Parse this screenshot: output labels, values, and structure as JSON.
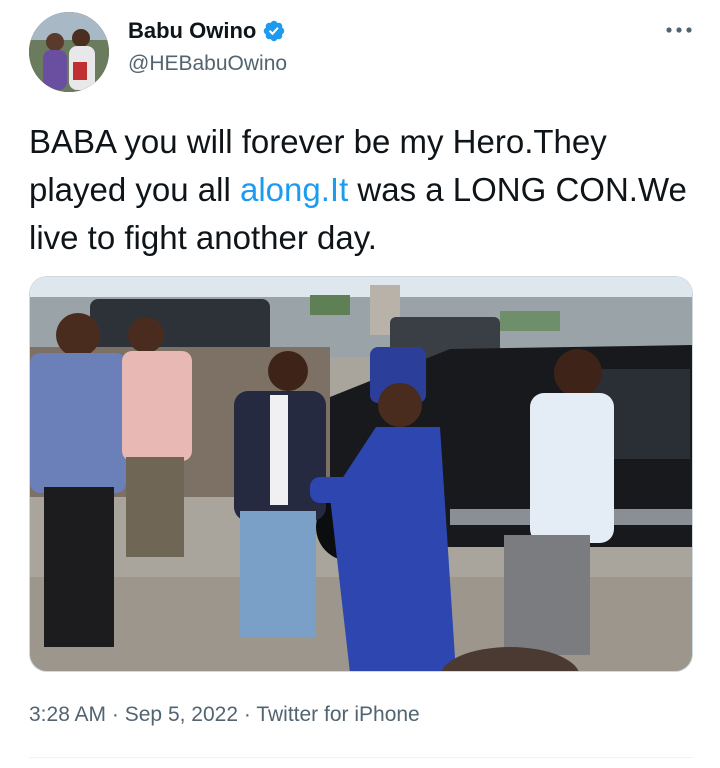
{
  "author": {
    "display_name": "Babu Owino",
    "handle": "@HEBabuOwino",
    "verified": true
  },
  "tweet": {
    "text_before_link": "BABA you will forever be my Hero.They played you all ",
    "link_text": "along.It",
    "text_after_link": " was a LONG CON.We live to fight another day."
  },
  "meta": {
    "time": "3:28 AM",
    "separator": "·",
    "date": "Sep 5, 2022",
    "source": "Twitter for iPhone"
  },
  "icons": {
    "verified": "verified-badge-icon",
    "more": "more-options-icon"
  },
  "colors": {
    "link": "#1d9bf0",
    "verified": "#1d9bf0",
    "secondary_text": "#536471"
  }
}
